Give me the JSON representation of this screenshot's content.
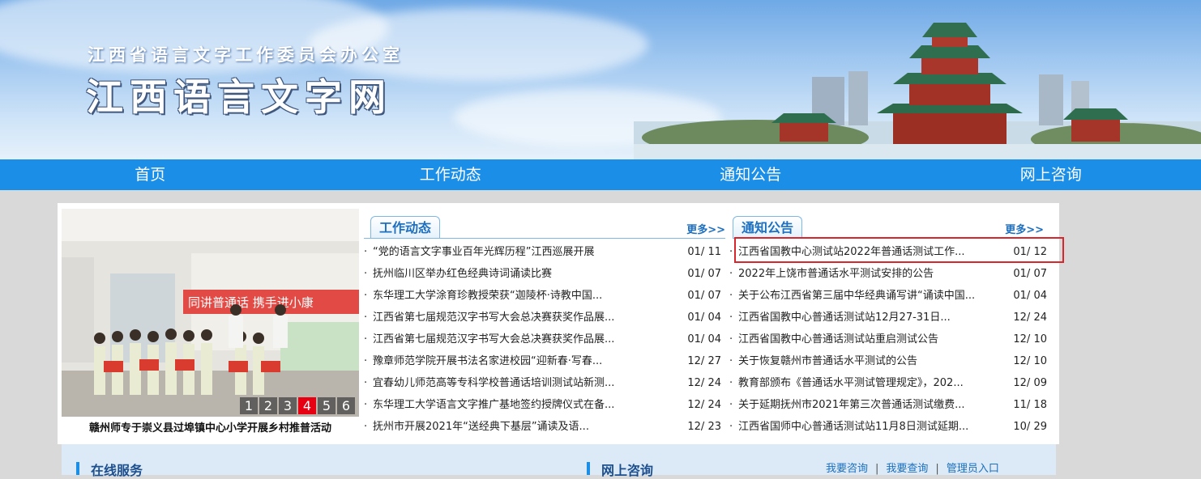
{
  "header": {
    "subtitle": "江西省语言文字工作委员会办公室",
    "title": "江西语言文字网"
  },
  "nav": [
    "首页",
    "工作动态",
    "通知公告",
    "网上咨询"
  ],
  "slider": {
    "caption": "赣州师专于崇义县过埠镇中心小学开展乡村推普活动",
    "pages": [
      "1",
      "2",
      "3",
      "4",
      "5",
      "6"
    ],
    "active_page": "4",
    "banner_text": "同讲普通话  携手进小康"
  },
  "work": {
    "tab": "工作动态",
    "more": "更多>>",
    "items": [
      {
        "title": "“党的语言文字事业百年光辉历程”江西巡展开展",
        "date": "01/ 11"
      },
      {
        "title": "抚州临川区举办红色经典诗词诵读比赛",
        "date": "01/ 07"
      },
      {
        "title": "东华理工大学涂育珍教授荣获“迦陵杯·诗教中国...",
        "date": "01/ 07"
      },
      {
        "title": "江西省第七届规范汉字书写大会总决赛获奖作品展...",
        "date": "01/ 04"
      },
      {
        "title": "江西省第七届规范汉字书写大会总决赛获奖作品展...",
        "date": "01/ 04"
      },
      {
        "title": "豫章师范学院开展书法名家进校园“迎新春·写春...",
        "date": "12/ 27"
      },
      {
        "title": "宜春幼儿师范高等专科学校普通话培训测试站新测...",
        "date": "12/ 24"
      },
      {
        "title": "东华理工大学语言文字推广基地签约授牌仪式在备...",
        "date": "12/ 24"
      },
      {
        "title": "抚州市开展2021年“送经典下基层”诵读及语...",
        "date": "12/ 23"
      }
    ]
  },
  "notice": {
    "tab": "通知公告",
    "more": "更多>>",
    "items": [
      {
        "title": "江西省国教中心测试站2022年普通话测试工作...",
        "date": "01/ 12"
      },
      {
        "title": "2022年上饶市普通话水平测试安排的公告",
        "date": "01/ 07"
      },
      {
        "title": "关于公布江西省第三届中华经典诵写讲“诵读中国...",
        "date": "01/ 04"
      },
      {
        "title": "江西省国教中心普通话测试站12月27-31日...",
        "date": "12/ 24"
      },
      {
        "title": "江西省国教中心普通话测试站重启测试公告",
        "date": "12/ 10"
      },
      {
        "title": "关于恢复赣州市普通话水平测试的公告",
        "date": "12/ 10"
      },
      {
        "title": "教育部颁布《普通话水平测试管理规定》，202...",
        "date": "12/ 09"
      },
      {
        "title": "关于延期抚州市2021年第三次普通话测试缴费...",
        "date": "11/ 18"
      },
      {
        "title": "江西省国师中心普通话测试站11月8日测试延期...",
        "date": "10/ 29"
      }
    ]
  },
  "bottom": {
    "online_service": "在线服务",
    "online_consult": "网上咨询",
    "links": [
      "我要咨询",
      "我要查询",
      "管理员入口"
    ],
    "separator": "|"
  },
  "colors": {
    "nav_bg": "#1b8fe8",
    "highlight_border": "#d9262c",
    "active_page": "#e60012"
  }
}
